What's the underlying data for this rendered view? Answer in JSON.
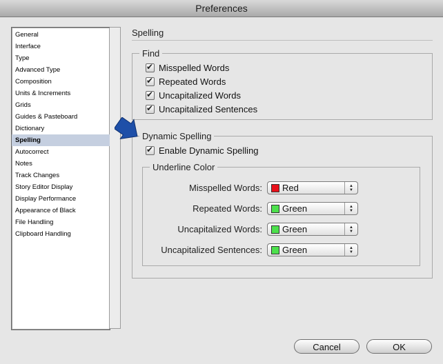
{
  "window": {
    "title": "Preferences"
  },
  "sidebar": {
    "items": [
      {
        "label": "General"
      },
      {
        "label": "Interface"
      },
      {
        "label": "Type"
      },
      {
        "label": "Advanced Type"
      },
      {
        "label": "Composition"
      },
      {
        "label": "Units & Increments"
      },
      {
        "label": "Grids"
      },
      {
        "label": "Guides & Pasteboard"
      },
      {
        "label": "Dictionary"
      },
      {
        "label": "Spelling",
        "selected": true
      },
      {
        "label": "Autocorrect"
      },
      {
        "label": "Notes"
      },
      {
        "label": "Track Changes"
      },
      {
        "label": "Story Editor Display"
      },
      {
        "label": "Display Performance"
      },
      {
        "label": "Appearance of Black"
      },
      {
        "label": "File Handling"
      },
      {
        "label": "Clipboard Handling"
      }
    ]
  },
  "panel": {
    "title": "Spelling",
    "find": {
      "label": "Find",
      "options": [
        {
          "label": "Misspelled Words",
          "checked": true
        },
        {
          "label": "Repeated Words",
          "checked": true
        },
        {
          "label": "Uncapitalized Words",
          "checked": true
        },
        {
          "label": "Uncapitalized Sentences",
          "checked": true
        }
      ]
    },
    "dynamic": {
      "label": "Dynamic Spelling",
      "enable_label": "Enable Dynamic Spelling",
      "enabled": true,
      "underline": {
        "label": "Underline Color",
        "rows": [
          {
            "label": "Misspelled Words:",
            "value": "Red",
            "color": "#e8101a"
          },
          {
            "label": "Repeated Words:",
            "value": "Green",
            "color": "#4ce04c"
          },
          {
            "label": "Uncapitalized Words:",
            "value": "Green",
            "color": "#4ce04c"
          },
          {
            "label": "Uncapitalized Sentences:",
            "value": "Green",
            "color": "#4ce04c"
          }
        ]
      }
    }
  },
  "buttons": {
    "cancel": "Cancel",
    "ok": "OK"
  },
  "colors": {
    "selection": "#c5cfe0",
    "arrow": "#1e4fa8"
  }
}
